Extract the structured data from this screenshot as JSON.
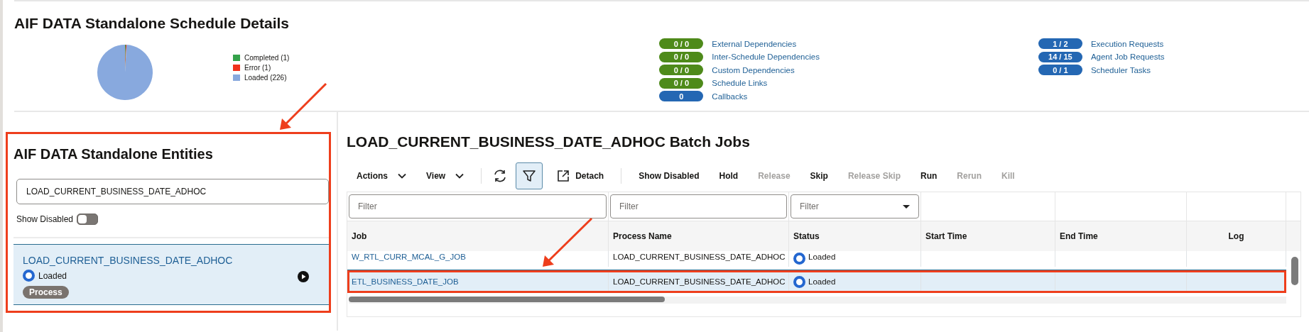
{
  "page_title": "AIF DATA Standalone Schedule Details",
  "summary": {
    "chart_data": {
      "type": "pie",
      "categories": [
        "Completed (1)",
        "Error (1)",
        "Loaded (226)"
      ],
      "values": [
        1,
        1,
        226
      ]
    },
    "legend": [
      {
        "color": "#34a24a"
      },
      {
        "color": "#f0321c"
      },
      {
        "color": "#88a9de"
      }
    ]
  },
  "dependencies": [
    {
      "count": "0 / 0",
      "label": "External Dependencies",
      "color": "#4e8a1a"
    },
    {
      "count": "0 / 0",
      "label": "Inter-Schedule Dependencies",
      "color": "#4e8a1a"
    },
    {
      "count": "0 / 0",
      "label": "Custom Dependencies",
      "color": "#4e8a1a"
    },
    {
      "count": "0 / 0",
      "label": "Schedule Links",
      "color": "#4e8a1a"
    },
    {
      "count": "0",
      "label": "Callbacks",
      "color": "#2467b3"
    }
  ],
  "requests": [
    {
      "count": "1 / 2",
      "label": "Execution Requests",
      "color": "#2467b3"
    },
    {
      "count": "14 / 15",
      "label": "Agent Job Requests",
      "color": "#2467b3"
    },
    {
      "count": "0 / 1",
      "label": "Scheduler Tasks",
      "color": "#2467b3"
    }
  ],
  "entities": {
    "title": "AIF DATA Standalone Entities",
    "search": {
      "value": "LOAD_CURRENT_BUSINESS_DATE_ADHOC"
    },
    "show_disabled": {
      "label": "Show Disabled",
      "on": false
    },
    "items": [
      {
        "name": "LOAD_CURRENT_BUSINESS_DATE_ADHOC",
        "status": "Loaded",
        "tag": "Process",
        "selected": true
      }
    ]
  },
  "batch_jobs": {
    "title": "LOAD_CURRENT_BUSINESS_DATE_ADHOC Batch Jobs",
    "toolbar": [
      {
        "kind": "menu",
        "label": "Actions"
      },
      {
        "kind": "menu",
        "label": "View"
      },
      {
        "kind": "separator"
      },
      {
        "kind": "refresh"
      },
      {
        "kind": "filter",
        "selected": true
      },
      {
        "kind": "detach",
        "label": "Detach"
      },
      {
        "kind": "separator"
      },
      {
        "kind": "action",
        "label": "Show Disabled",
        "disabled": false
      },
      {
        "kind": "action",
        "label": "Hold",
        "disabled": false
      },
      {
        "kind": "action",
        "label": "Release",
        "disabled": true
      },
      {
        "kind": "action",
        "label": "Skip",
        "disabled": false
      },
      {
        "kind": "action",
        "label": "Release Skip",
        "disabled": true
      },
      {
        "kind": "action",
        "label": "Run",
        "disabled": false
      },
      {
        "kind": "action",
        "label": "Rerun",
        "disabled": true
      },
      {
        "kind": "action",
        "label": "Kill",
        "disabled": true
      }
    ],
    "filters": [
      {
        "kind": "text",
        "placeholder": "Filter"
      },
      {
        "kind": "text",
        "placeholder": "Filter"
      },
      {
        "kind": "select",
        "placeholder": "Filter"
      }
    ],
    "columns": [
      "Job",
      "Process Name",
      "Status",
      "Start Time",
      "End Time",
      "Log"
    ],
    "rows": [
      {
        "job": "W_RTL_CURR_MCAL_G_JOB",
        "process": "LOAD_CURRENT_BUSINESS_DATE_ADHOC",
        "status": "Loaded",
        "selected": false
      },
      {
        "job": "ETL_BUSINESS_DATE_JOB",
        "process": "LOAD_CURRENT_BUSINESS_DATE_ADHOC",
        "status": "Loaded",
        "selected": true
      }
    ]
  }
}
